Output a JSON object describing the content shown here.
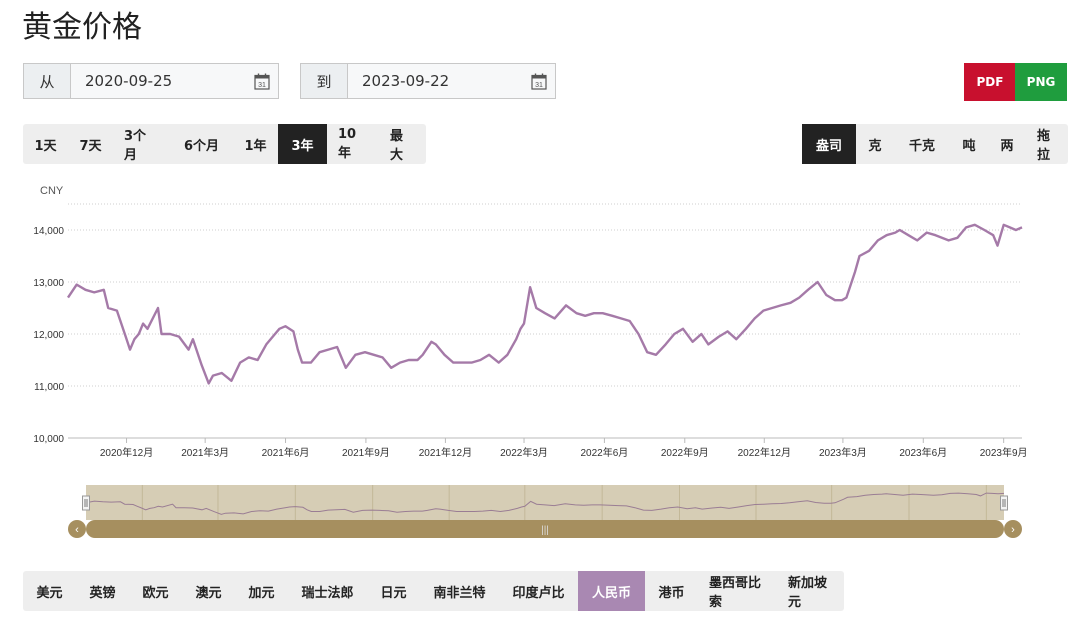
{
  "page": {
    "title": "黄金价格"
  },
  "date_range": {
    "from_label": "从",
    "from_value": "2020-09-25",
    "to_label": "到",
    "to_value": "2023-09-22"
  },
  "export": {
    "pdf": "PDF",
    "png": "PNG",
    "pdf_color": "#c8102e",
    "png_color": "#1f9d3e"
  },
  "ranges": {
    "items": [
      "1天",
      "7天",
      "3个月",
      "6个月",
      "1年",
      "3年",
      "10年",
      "最大"
    ],
    "active": "3年"
  },
  "units": {
    "items": [
      "盎司",
      "克",
      "千克",
      "吨",
      "两",
      "拖拉"
    ],
    "active": "盎司"
  },
  "currencies": {
    "items": [
      "美元",
      "英镑",
      "欧元",
      "澳元",
      "加元",
      "瑞士法郎",
      "日元",
      "南非兰特",
      "印度卢比",
      "人民币",
      "港币",
      "墨西哥比索",
      "新加坡元"
    ],
    "active": "人民币"
  },
  "colors": {
    "line": "#a57aa8",
    "navigator_fill": "#d6cdb5",
    "navigator_handle": "#a68f5f"
  },
  "chart_data": {
    "type": "line",
    "unit_label": "CNY",
    "ylim": [
      10000,
      14500
    ],
    "yticks": [
      10000,
      11000,
      12000,
      13000,
      14000
    ],
    "ytick_labels": [
      "10,000",
      "11,000",
      "12,000",
      "13,000",
      "14,000"
    ],
    "xlim": [
      "2020-09-25",
      "2023-09-22"
    ],
    "xticks": [
      "2020-12-01",
      "2021-03-01",
      "2021-06-01",
      "2021-09-01",
      "2021-12-01",
      "2022-03-01",
      "2022-06-01",
      "2022-09-01",
      "2022-12-01",
      "2023-03-01",
      "2023-06-01",
      "2023-09-01"
    ],
    "xtick_labels": [
      "2020年12月",
      "2021年3月",
      "2021年6月",
      "2021年9月",
      "2021年12月",
      "2022年3月",
      "2022年6月",
      "2022年9月",
      "2022年12月",
      "2023年3月",
      "2023年6月",
      "2023年9月"
    ],
    "grid": true,
    "series": [
      {
        "points": [
          [
            "2020-09-25",
            12700
          ],
          [
            "2020-10-05",
            12950
          ],
          [
            "2020-10-15",
            12850
          ],
          [
            "2020-10-25",
            12800
          ],
          [
            "2020-11-05",
            12850
          ],
          [
            "2020-11-10",
            12500
          ],
          [
            "2020-11-20",
            12450
          ],
          [
            "2020-11-25",
            12200
          ],
          [
            "2020-11-30",
            11950
          ],
          [
            "2020-12-05",
            11700
          ],
          [
            "2020-12-10",
            11900
          ],
          [
            "2020-12-15",
            12000
          ],
          [
            "2020-12-20",
            12200
          ],
          [
            "2020-12-25",
            12100
          ],
          [
            "2021-01-06",
            12500
          ],
          [
            "2021-01-10",
            12000
          ],
          [
            "2021-01-20",
            12000
          ],
          [
            "2021-01-30",
            11950
          ],
          [
            "2021-02-10",
            11700
          ],
          [
            "2021-02-15",
            11900
          ],
          [
            "2021-02-25",
            11400
          ],
          [
            "2021-03-05",
            11050
          ],
          [
            "2021-03-10",
            11200
          ],
          [
            "2021-03-20",
            11250
          ],
          [
            "2021-03-31",
            11100
          ],
          [
            "2021-04-10",
            11450
          ],
          [
            "2021-04-20",
            11550
          ],
          [
            "2021-04-30",
            11500
          ],
          [
            "2021-05-10",
            11800
          ],
          [
            "2021-05-20",
            12000
          ],
          [
            "2021-05-25",
            12100
          ],
          [
            "2021-06-01",
            12150
          ],
          [
            "2021-06-10",
            12050
          ],
          [
            "2021-06-15",
            11700
          ],
          [
            "2021-06-20",
            11450
          ],
          [
            "2021-06-30",
            11450
          ],
          [
            "2021-07-10",
            11650
          ],
          [
            "2021-07-20",
            11700
          ],
          [
            "2021-07-30",
            11750
          ],
          [
            "2021-08-09",
            11350
          ],
          [
            "2021-08-20",
            11600
          ],
          [
            "2021-08-31",
            11650
          ],
          [
            "2021-09-10",
            11600
          ],
          [
            "2021-09-20",
            11550
          ],
          [
            "2021-09-30",
            11350
          ],
          [
            "2021-10-10",
            11450
          ],
          [
            "2021-10-20",
            11500
          ],
          [
            "2021-10-30",
            11500
          ],
          [
            "2021-11-05",
            11600
          ],
          [
            "2021-11-15",
            11850
          ],
          [
            "2021-11-20",
            11800
          ],
          [
            "2021-11-30",
            11600
          ],
          [
            "2021-12-10",
            11450
          ],
          [
            "2021-12-20",
            11450
          ],
          [
            "2021-12-31",
            11450
          ],
          [
            "2022-01-10",
            11500
          ],
          [
            "2022-01-20",
            11600
          ],
          [
            "2022-01-31",
            11450
          ],
          [
            "2022-02-10",
            11600
          ],
          [
            "2022-02-20",
            11900
          ],
          [
            "2022-02-25",
            12100
          ],
          [
            "2022-03-01",
            12200
          ],
          [
            "2022-03-08",
            12900
          ],
          [
            "2022-03-15",
            12500
          ],
          [
            "2022-03-25",
            12400
          ],
          [
            "2022-04-05",
            12300
          ],
          [
            "2022-04-18",
            12550
          ],
          [
            "2022-04-30",
            12400
          ],
          [
            "2022-05-10",
            12350
          ],
          [
            "2022-05-20",
            12400
          ],
          [
            "2022-05-30",
            12400
          ],
          [
            "2022-06-10",
            12350
          ],
          [
            "2022-06-20",
            12300
          ],
          [
            "2022-06-30",
            12250
          ],
          [
            "2022-07-10",
            12000
          ],
          [
            "2022-07-20",
            11650
          ],
          [
            "2022-07-30",
            11600
          ],
          [
            "2022-08-10",
            11800
          ],
          [
            "2022-08-20",
            12000
          ],
          [
            "2022-08-30",
            12100
          ],
          [
            "2022-09-10",
            11850
          ],
          [
            "2022-09-20",
            12000
          ],
          [
            "2022-09-28",
            11800
          ],
          [
            "2022-10-10",
            11950
          ],
          [
            "2022-10-20",
            12050
          ],
          [
            "2022-10-30",
            11900
          ],
          [
            "2022-11-10",
            12100
          ],
          [
            "2022-11-20",
            12300
          ],
          [
            "2022-11-30",
            12450
          ],
          [
            "2022-12-10",
            12500
          ],
          [
            "2022-12-20",
            12550
          ],
          [
            "2022-12-31",
            12600
          ],
          [
            "2023-01-10",
            12700
          ],
          [
            "2023-01-20",
            12850
          ],
          [
            "2023-01-31",
            13000
          ],
          [
            "2023-02-10",
            12750
          ],
          [
            "2023-02-20",
            12650
          ],
          [
            "2023-02-28",
            12650
          ],
          [
            "2023-03-05",
            12700
          ],
          [
            "2023-03-15",
            13200
          ],
          [
            "2023-03-20",
            13500
          ],
          [
            "2023-03-31",
            13600
          ],
          [
            "2023-04-10",
            13800
          ],
          [
            "2023-04-20",
            13900
          ],
          [
            "2023-04-30",
            13950
          ],
          [
            "2023-05-05",
            14000
          ],
          [
            "2023-05-15",
            13900
          ],
          [
            "2023-05-25",
            13800
          ],
          [
            "2023-06-05",
            13950
          ],
          [
            "2023-06-15",
            13900
          ],
          [
            "2023-06-30",
            13800
          ],
          [
            "2023-07-10",
            13850
          ],
          [
            "2023-07-20",
            14050
          ],
          [
            "2023-07-30",
            14100
          ],
          [
            "2023-08-10",
            14000
          ],
          [
            "2023-08-20",
            13900
          ],
          [
            "2023-08-25",
            13700
          ],
          [
            "2023-09-01",
            14100
          ],
          [
            "2023-09-08",
            14050
          ],
          [
            "2023-09-15",
            14000
          ],
          [
            "2023-09-22",
            14050
          ]
        ]
      }
    ]
  }
}
